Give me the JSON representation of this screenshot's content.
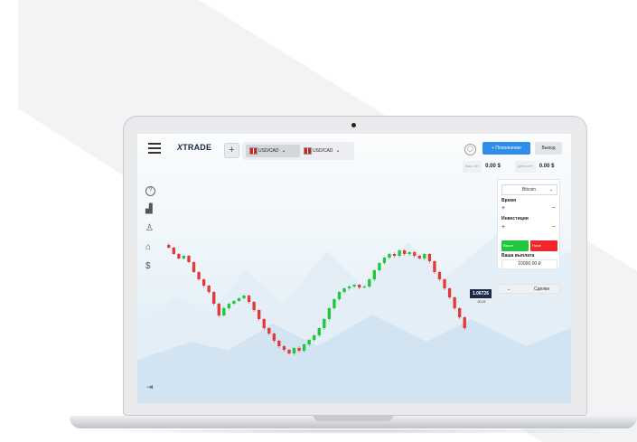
{
  "header": {
    "logo_text": "TRADE",
    "logo_mark": "X",
    "add_button": "+",
    "pairs": [
      {
        "label": "USD/CAD"
      },
      {
        "label": "USD/CAD"
      }
    ],
    "deposit_label": "+ Пополнение",
    "withdraw_label": "Вывод"
  },
  "balances": [
    {
      "label": "Ваш счёт",
      "value": "0.00 $"
    },
    {
      "label": "Демо счёт",
      "value": "0.00 $"
    }
  ],
  "sidebar": {
    "items": [
      {
        "name": "help",
        "icon": "question-icon"
      },
      {
        "name": "stats",
        "icon": "chart-icon"
      },
      {
        "name": "profile",
        "icon": "user-icon"
      },
      {
        "name": "education",
        "icon": "graduation-cap-icon"
      },
      {
        "name": "finance",
        "icon": "dollar-icon"
      }
    ],
    "logout_icon": "logout-icon"
  },
  "trade_panel": {
    "asset": "Bitcoin",
    "time_label": "Время",
    "investment_label": "Инвестиции",
    "up_label": "Выше",
    "down_label": "Ниже",
    "payout_label": "Ваша выплата",
    "payout_value": "10000.00 ₽",
    "deals_label": "Сделки"
  },
  "chart": {
    "current_price": "1.06726",
    "timer": "00:15",
    "accent_up": "#1ec73d",
    "accent_down": "#e53935"
  },
  "chart_data": {
    "type": "candlestick",
    "candles": [
      [
        80,
        83,
        78,
        84
      ],
      [
        83,
        90,
        82,
        91
      ],
      [
        90,
        95,
        89,
        96
      ],
      [
        95,
        92,
        91,
        96
      ],
      [
        92,
        99,
        91,
        100
      ],
      [
        99,
        110,
        98,
        111
      ],
      [
        110,
        118,
        109,
        120
      ],
      [
        118,
        125,
        117,
        127
      ],
      [
        125,
        132,
        124,
        134
      ],
      [
        132,
        145,
        131,
        147
      ],
      [
        145,
        158,
        144,
        160
      ],
      [
        158,
        150,
        148,
        159
      ],
      [
        150,
        145,
        144,
        152
      ],
      [
        145,
        142,
        141,
        146
      ],
      [
        142,
        139,
        138,
        143
      ],
      [
        139,
        136,
        135,
        140
      ],
      [
        136,
        143,
        135,
        145
      ],
      [
        143,
        152,
        142,
        154
      ],
      [
        152,
        162,
        151,
        164
      ],
      [
        162,
        172,
        161,
        174
      ],
      [
        172,
        178,
        171,
        180
      ],
      [
        178,
        186,
        177,
        188
      ],
      [
        186,
        192,
        185,
        194
      ],
      [
        192,
        196,
        191,
        198
      ],
      [
        196,
        200,
        195,
        201
      ],
      [
        200,
        194,
        193,
        202
      ],
      [
        194,
        197,
        192,
        199
      ],
      [
        197,
        190,
        189,
        199
      ],
      [
        190,
        185,
        184,
        192
      ],
      [
        185,
        180,
        179,
        187
      ],
      [
        180,
        172,
        171,
        182
      ],
      [
        172,
        162,
        161,
        174
      ],
      [
        162,
        150,
        149,
        164
      ],
      [
        150,
        140,
        139,
        152
      ],
      [
        140,
        132,
        131,
        142
      ],
      [
        132,
        128,
        127,
        134
      ],
      [
        128,
        126,
        125,
        130
      ],
      [
        126,
        124,
        123,
        128
      ],
      [
        124,
        127,
        123,
        129
      ],
      [
        127,
        126,
        124,
        128
      ],
      [
        126,
        118,
        117,
        128
      ],
      [
        118,
        108,
        107,
        120
      ],
      [
        108,
        100,
        99,
        110
      ],
      [
        100,
        94,
        93,
        102
      ],
      [
        94,
        90,
        89,
        96
      ],
      [
        90,
        92,
        88,
        94
      ],
      [
        92,
        86,
        85,
        94
      ],
      [
        86,
        90,
        85,
        92
      ],
      [
        90,
        88,
        87,
        92
      ],
      [
        88,
        92,
        87,
        94
      ],
      [
        92,
        95,
        91,
        96
      ],
      [
        95,
        90,
        89,
        97
      ],
      [
        90,
        98,
        89,
        100
      ],
      [
        98,
        110,
        97,
        112
      ],
      [
        110,
        118,
        109,
        120
      ],
      [
        118,
        128,
        117,
        130
      ],
      [
        128,
        138,
        127,
        140
      ],
      [
        138,
        150,
        137,
        152
      ],
      [
        150,
        160,
        149,
        162
      ],
      [
        160,
        172,
        159,
        174
      ]
    ]
  }
}
